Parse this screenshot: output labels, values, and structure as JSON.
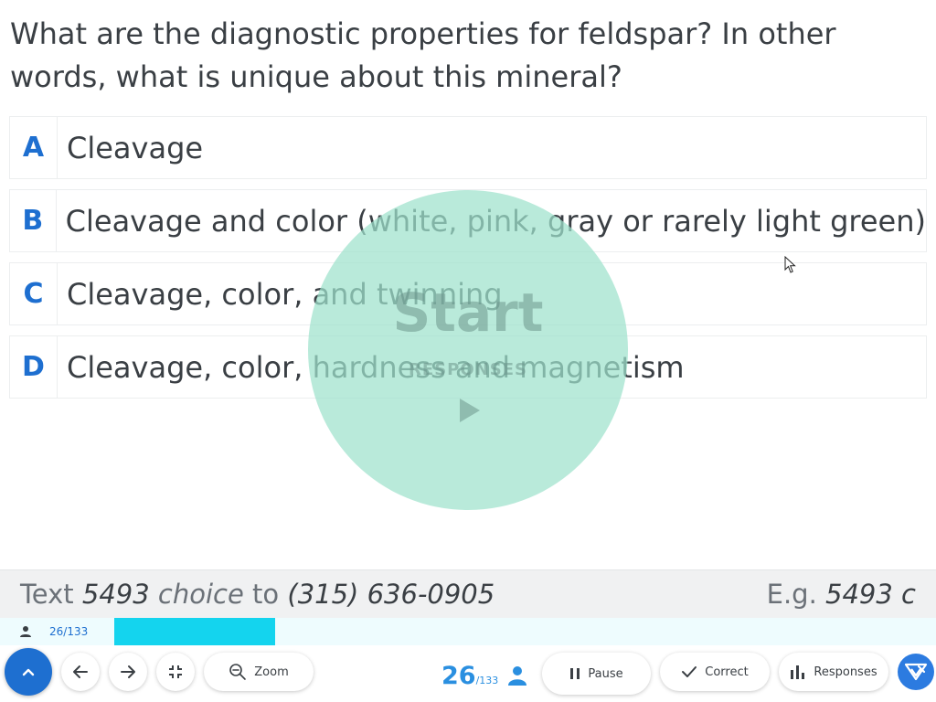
{
  "question": {
    "text": "What are the diagnostic properties for feldspar?  In other words, what is unique about this mineral?"
  },
  "choices": [
    {
      "letter": "A",
      "text": "Cleavage"
    },
    {
      "letter": "B",
      "text": "Cleavage and color (white, pink, gray or rarely light green)"
    },
    {
      "letter": "C",
      "text": "Cleavage, color, and twinning"
    },
    {
      "letter": "D",
      "text": "Cleavage, color, hardness and magnetism"
    }
  ],
  "overlay": {
    "start_label": "Start",
    "sub_label": "RESPONSES"
  },
  "text_bar": {
    "prefix": "Text",
    "code": "5493",
    "choice_word": "choice",
    "to_word": "to",
    "phone": "(315) 636-0905",
    "example_prefix": "E.g.",
    "example": "5493 c"
  },
  "progress": {
    "count_label": "26/133",
    "fraction": 0.1955
  },
  "toolbar": {
    "zoom_label": "Zoom",
    "current": "26",
    "total": "/133",
    "pause_label": "Pause",
    "correct_label": "Correct",
    "responses_label": "Responses"
  },
  "colors": {
    "accent": "#1e6fd0",
    "progress_fill": "#14d4ee",
    "overlay": "#9ee2cc"
  }
}
